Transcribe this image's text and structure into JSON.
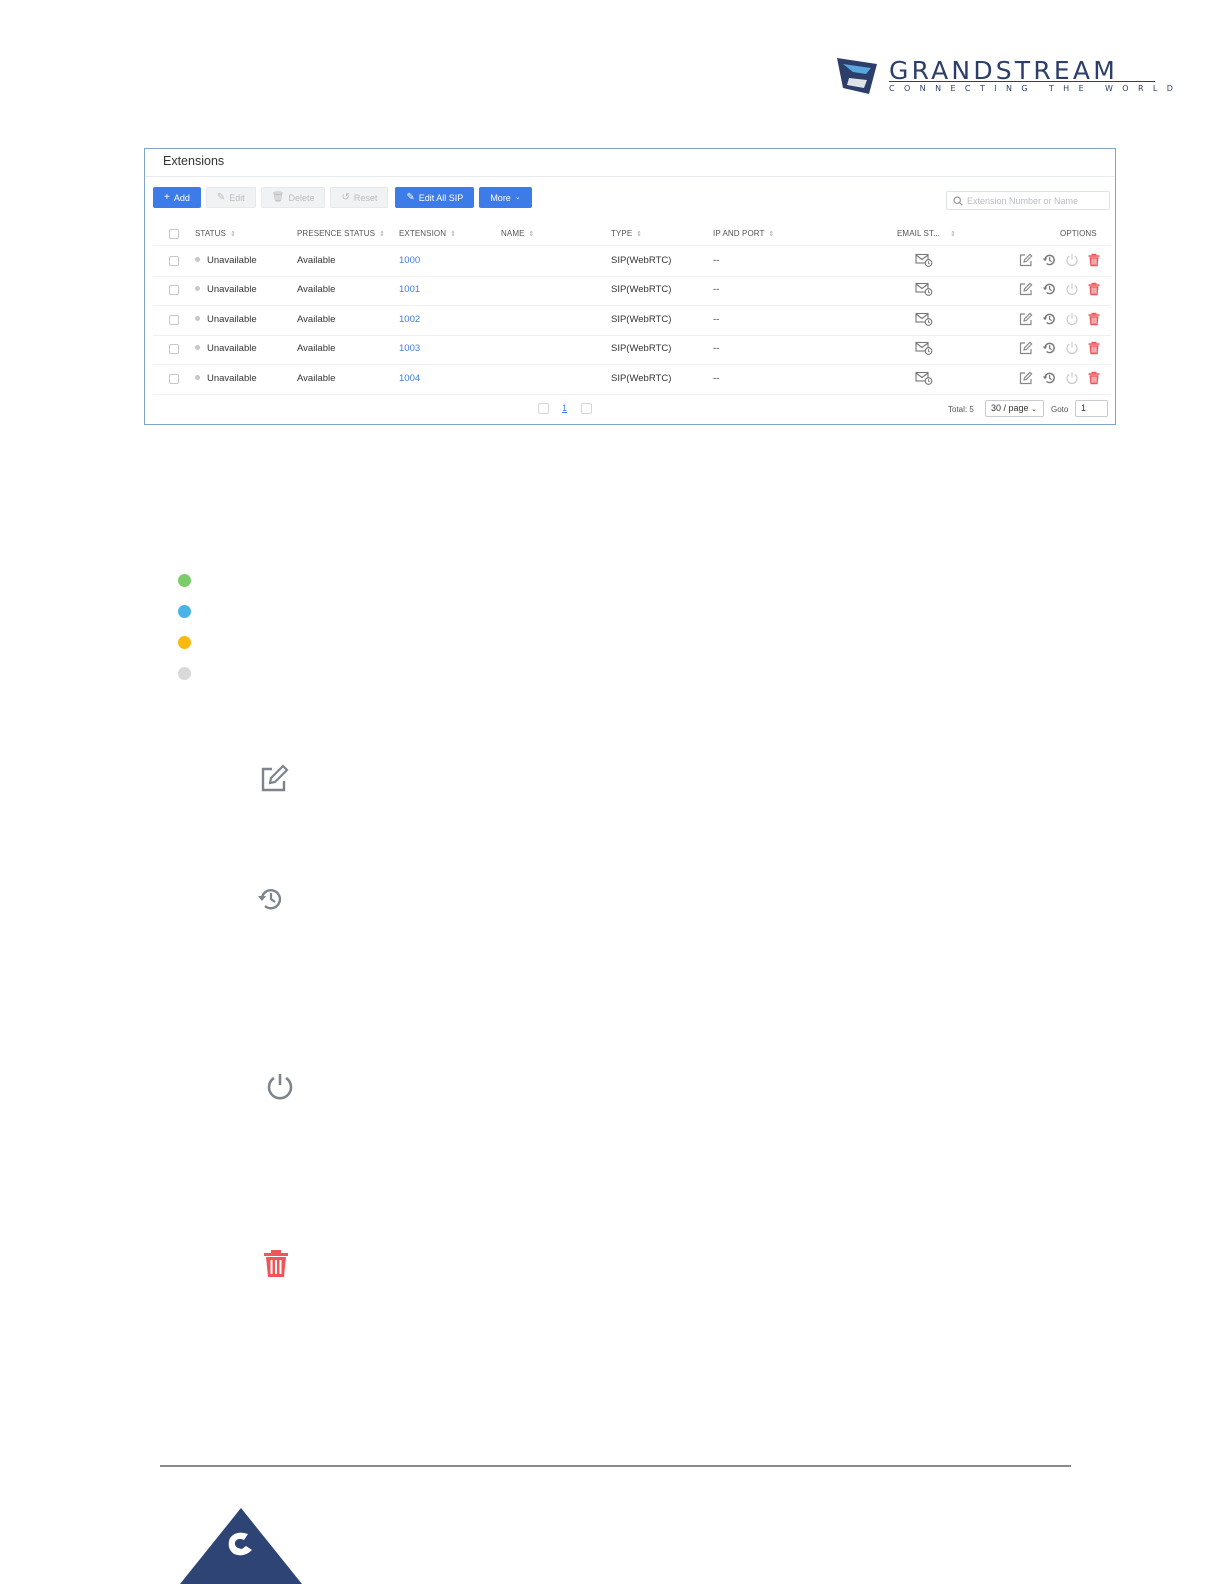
{
  "brand": {
    "name": "GRANDSTREAM",
    "tagline": "CONNECTING THE WORLD",
    "color": "#2d3e6a"
  },
  "panel": {
    "title": "Extensions",
    "toolbar": {
      "add": "Add",
      "edit": "Edit",
      "delete": "Delete",
      "reset": "Reset",
      "edit_all_sip": "Edit All SIP",
      "more": "More"
    },
    "search": {
      "placeholder": "Extension Number or Name"
    },
    "columns": {
      "status": "STATUS",
      "presence": "PRESENCE STATUS",
      "extension": "EXTENSION",
      "name": "NAME",
      "type": "TYPE",
      "ip_port": "IP AND PORT",
      "email": "EMAIL ST...",
      "options": "OPTIONS"
    },
    "rows": [
      {
        "status": "Unavailable",
        "presence": "Available",
        "extension": "1000",
        "name": "",
        "type": "SIP(WebRTC)",
        "ip_port": "--"
      },
      {
        "status": "Unavailable",
        "presence": "Available",
        "extension": "1001",
        "name": "",
        "type": "SIP(WebRTC)",
        "ip_port": "--"
      },
      {
        "status": "Unavailable",
        "presence": "Available",
        "extension": "1002",
        "name": "",
        "type": "SIP(WebRTC)",
        "ip_port": "--"
      },
      {
        "status": "Unavailable",
        "presence": "Available",
        "extension": "1003",
        "name": "",
        "type": "SIP(WebRTC)",
        "ip_port": "--"
      },
      {
        "status": "Unavailable",
        "presence": "Available",
        "extension": "1004",
        "name": "",
        "type": "SIP(WebRTC)",
        "ip_port": "--"
      }
    ],
    "pagination": {
      "current_page": "1",
      "total_label": "Total: 5",
      "page_size": "30 / page",
      "goto_label": "Goto",
      "goto_value": "1"
    }
  },
  "legend": {
    "colors": [
      "#7ccc6c",
      "#49b3e8",
      "#fbb80f",
      "#d9d9d9"
    ]
  },
  "icons": {
    "edit": "edit-icon",
    "reset": "reset-history-icon",
    "reboot": "power-icon",
    "delete": "trash-icon"
  },
  "colors": {
    "accent": "#3d7ce8",
    "danger": "#f0555a",
    "status_unavailable": "#c8c8c8"
  }
}
